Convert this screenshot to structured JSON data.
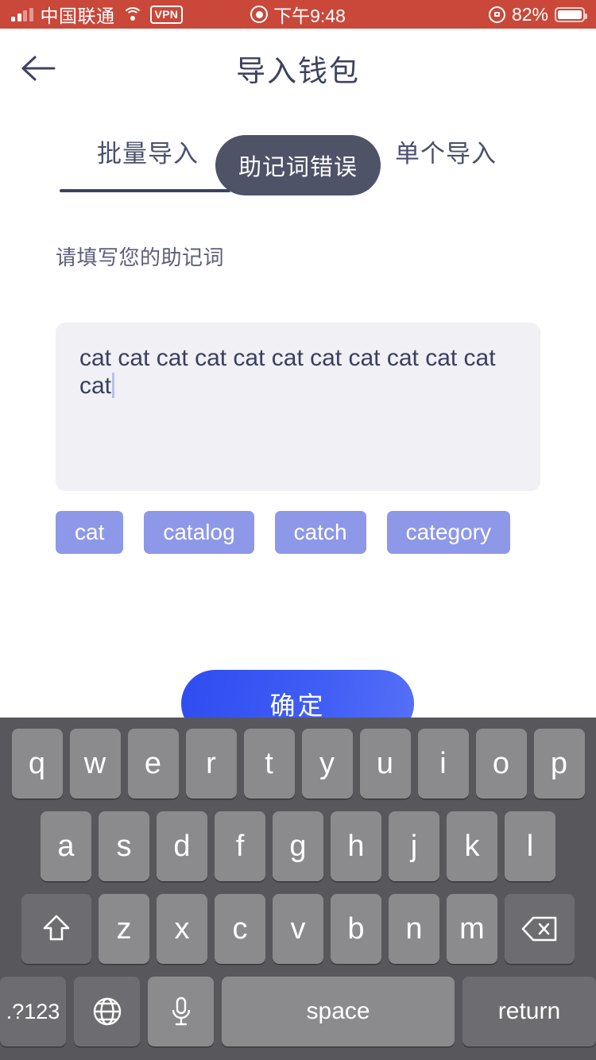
{
  "status_bar": {
    "carrier": "中国联通",
    "vpn_badge": "VPN",
    "time": "下午9:48",
    "battery_percent": "82%",
    "icons": {
      "signal": "signal-bars-icon",
      "wifi": "wifi-icon",
      "recording": "recording-indicator-icon",
      "rotation_lock": "rotation-lock-icon",
      "battery": "battery-icon"
    },
    "background_color": "#c9483a"
  },
  "header": {
    "title": "导入钱包",
    "back_icon": "back-arrow-icon",
    "title_color": "#3d4260"
  },
  "tabs": [
    {
      "label": "批量导入",
      "active": true
    },
    {
      "label": "单个导入",
      "active": false
    }
  ],
  "toast": {
    "message": "助记词错误",
    "background_color": "#4e5368"
  },
  "form": {
    "field_label": "请填写您的助记词",
    "mnemonic_value": "cat cat cat cat cat cat cat cat cat cat cat cat",
    "mnemonic_placeholder": "请填写您的助记词",
    "box_background": "#f0f0f5"
  },
  "suggestions": {
    "chip_color": "#8e98e8",
    "items": [
      "cat",
      "catalog",
      "catch",
      "category"
    ]
  },
  "confirm_button": {
    "label": "确定",
    "gradient_from": "#2f4df0",
    "gradient_to": "#5570f7"
  },
  "keyboard": {
    "background_color": "#58585c",
    "key_color": "#8b8b8e",
    "modifier_key_color": "#6d6d71",
    "row1": [
      "q",
      "w",
      "e",
      "r",
      "t",
      "y",
      "u",
      "i",
      "o",
      "p"
    ],
    "row2": [
      "a",
      "s",
      "d",
      "f",
      "g",
      "h",
      "j",
      "k",
      "l"
    ],
    "row3": [
      "z",
      "x",
      "c",
      "v",
      "b",
      "n",
      "m"
    ],
    "shift_icon": "shift-icon",
    "backspace_icon": "backspace-icon",
    "numeric_label": ".?123",
    "globe_icon": "globe-icon",
    "mic_icon": "microphone-icon",
    "space_label": "space",
    "return_label": "return"
  }
}
